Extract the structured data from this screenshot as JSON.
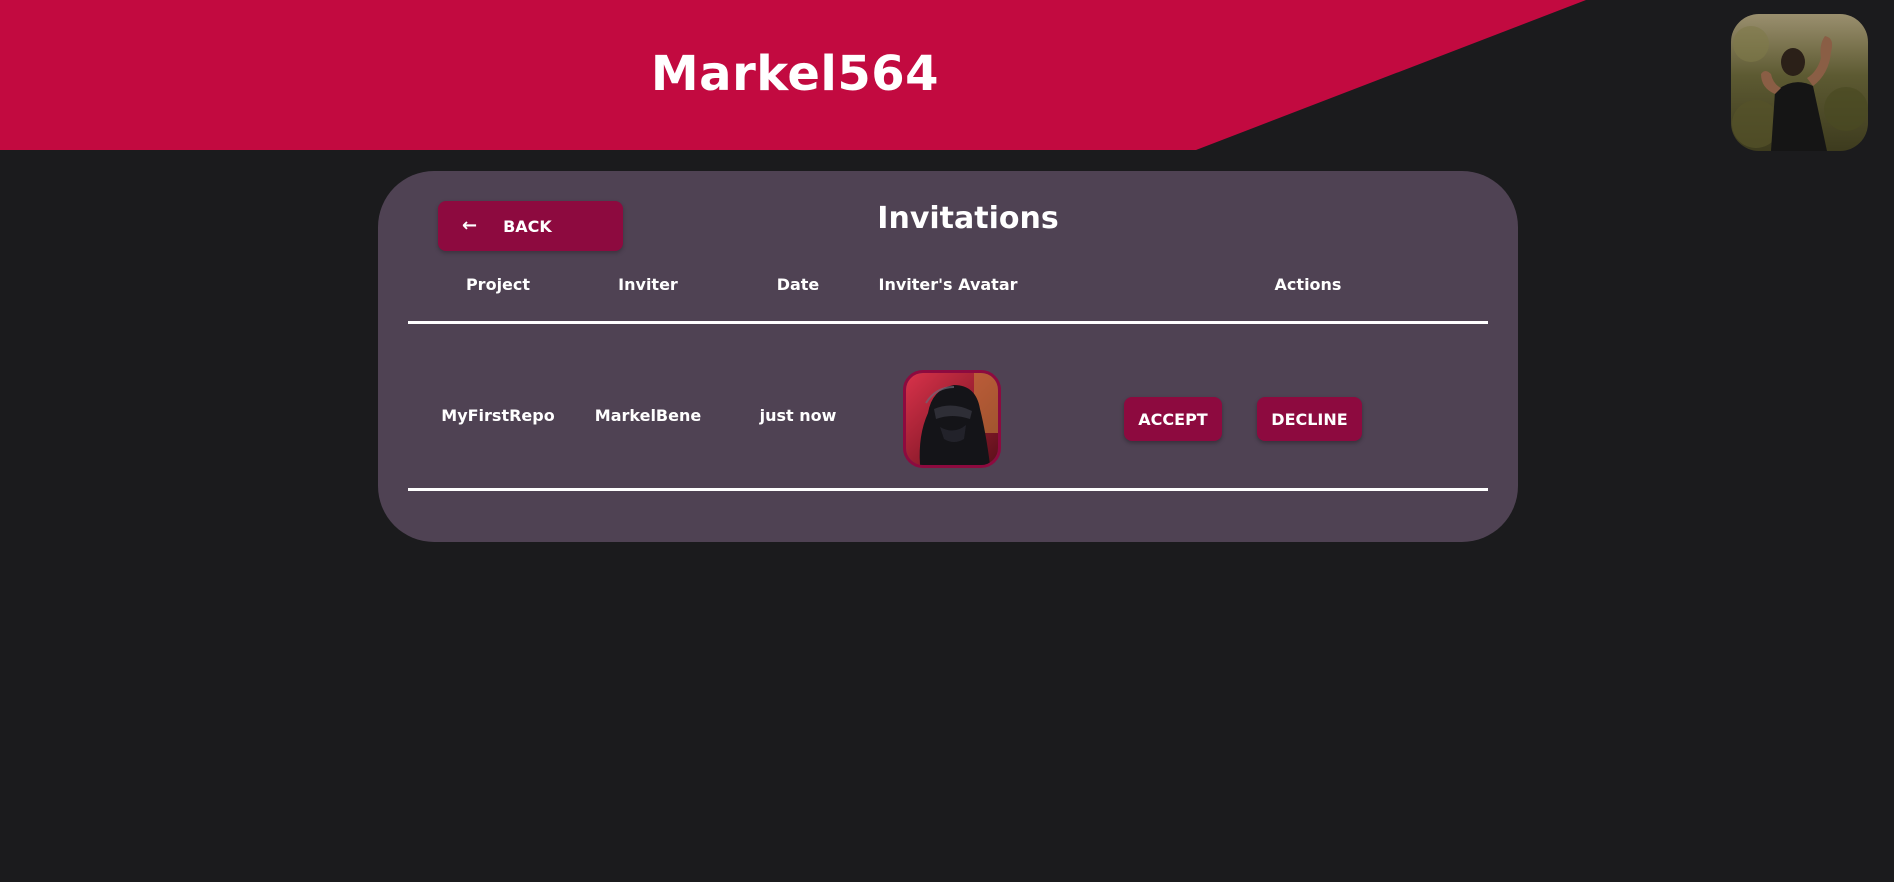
{
  "header": {
    "username": "Markel564",
    "banner_color": "#c20a40",
    "background_color": "#1b1b1d",
    "profile_avatar_icon": "profile-photo"
  },
  "invitations": {
    "title": "Invitations",
    "back_button": {
      "label": "BACK",
      "icon": "arrow-left-icon",
      "arrow": "←"
    },
    "columns": [
      "Project",
      "Inviter",
      "Date",
      "Inviter's Avatar",
      "Actions"
    ],
    "rows": [
      {
        "project": "MyFirstRepo",
        "inviter": "MarkelBene",
        "date": "just now",
        "avatar_icon": "helmet-avatar",
        "accept_label": "ACCEPT",
        "decline_label": "DECLINE"
      }
    ],
    "card_color": "#4f4253",
    "button_color": "#8d0a3f"
  }
}
